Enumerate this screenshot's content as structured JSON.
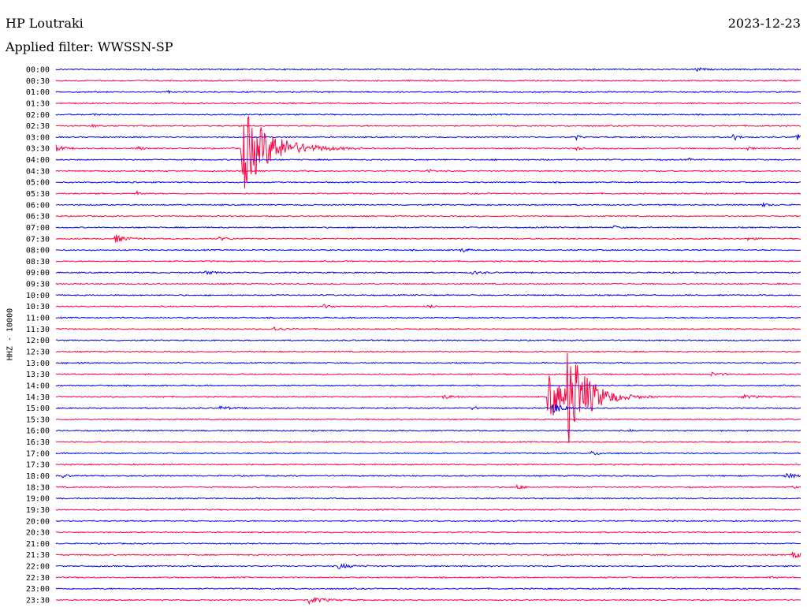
{
  "header": {
    "station": "HP Loutraki",
    "date": "2023-12-23",
    "filter": "Applied filter: WWSSN-SP",
    "channel": "HHZ - 10000"
  },
  "colors": {
    "background": "#ffffff",
    "trace_even": "#0000ee",
    "trace_odd": "#ff0040",
    "text": "#000000"
  },
  "chart_data": {
    "type": "line",
    "subtype": "helicorder",
    "grid": false,
    "time_labels": [
      "00:00",
      "00:30",
      "01:00",
      "01:30",
      "02:00",
      "02:30",
      "03:00",
      "03:30",
      "04:00",
      "04:30",
      "05:00",
      "05:30",
      "06:00",
      "06:30",
      "07:00",
      "07:30",
      "08:00",
      "08:30",
      "09:00",
      "09:30",
      "10:00",
      "10:30",
      "11:00",
      "11:30",
      "12:00",
      "12:30",
      "13:00",
      "13:30",
      "14:00",
      "14:30",
      "15:00",
      "15:30",
      "16:00",
      "16:30",
      "17:00",
      "17:30",
      "18:00",
      "18:30",
      "19:00",
      "19:30",
      "20:00",
      "20:30",
      "21:00",
      "21:30",
      "22:00",
      "22:30",
      "23:00",
      "23:30"
    ],
    "events": [
      {
        "line": 0,
        "x": 0.86,
        "amp": 3,
        "dur": 0.01
      },
      {
        "line": 2,
        "x": 0.15,
        "amp": 1.5,
        "dur": 0.005
      },
      {
        "line": 4,
        "x": 0.05,
        "amp": 1,
        "dur": 0.01
      },
      {
        "line": 5,
        "x": 0.05,
        "amp": 1.5,
        "dur": 0.01
      },
      {
        "line": 6,
        "x": 0.7,
        "amp": 3,
        "dur": 0.005
      },
      {
        "line": 6,
        "x": 0.91,
        "amp": 4,
        "dur": 0.01
      },
      {
        "line": 6,
        "x": 0.995,
        "amp": 8,
        "dur": 0.005
      },
      {
        "line": 7,
        "x": 0.0,
        "amp": 4,
        "dur": 0.015
      },
      {
        "line": 7,
        "x": 0.11,
        "amp": 2,
        "dur": 0.015
      },
      {
        "line": 7,
        "x": 0.25,
        "amp": 55,
        "dur": 0.055
      },
      {
        "line": 7,
        "x": 0.7,
        "amp": 2,
        "dur": 0.01
      },
      {
        "line": 7,
        "x": 0.93,
        "amp": 2,
        "dur": 0.01
      },
      {
        "line": 8,
        "x": 0.85,
        "amp": 2,
        "dur": 0.005
      },
      {
        "line": 9,
        "x": 0.5,
        "amp": 2,
        "dur": 0.01
      },
      {
        "line": 10,
        "x": 0.1,
        "amp": 1,
        "dur": 0.01
      },
      {
        "line": 11,
        "x": 0.11,
        "amp": 2,
        "dur": 0.01
      },
      {
        "line": 12,
        "x": 0.95,
        "amp": 2,
        "dur": 0.01
      },
      {
        "line": 14,
        "x": 0.75,
        "amp": 2,
        "dur": 0.01
      },
      {
        "line": 15,
        "x": 0.08,
        "amp": 5,
        "dur": 0.02
      },
      {
        "line": 15,
        "x": 0.22,
        "amp": 2,
        "dur": 0.02
      },
      {
        "line": 15,
        "x": 0.93,
        "amp": 2,
        "dur": 0.01
      },
      {
        "line": 16,
        "x": 0.545,
        "amp": 4,
        "dur": 0.008
      },
      {
        "line": 18,
        "x": 0.2,
        "amp": 2,
        "dur": 0.02
      },
      {
        "line": 18,
        "x": 0.56,
        "amp": 2,
        "dur": 0.02
      },
      {
        "line": 21,
        "x": 0.36,
        "amp": 2,
        "dur": 0.02
      },
      {
        "line": 21,
        "x": 0.5,
        "amp": 2,
        "dur": 0.01
      },
      {
        "line": 23,
        "x": 0.29,
        "amp": 3,
        "dur": 0.02
      },
      {
        "line": 26,
        "x": 0.03,
        "amp": 1.5,
        "dur": 0.01
      },
      {
        "line": 27,
        "x": 0.88,
        "amp": 2,
        "dur": 0.02
      },
      {
        "line": 29,
        "x": 0.14,
        "amp": 1.5,
        "dur": 0.01
      },
      {
        "line": 29,
        "x": 0.52,
        "amp": 2.5,
        "dur": 0.02
      },
      {
        "line": 29,
        "x": 0.92,
        "amp": 2,
        "dur": 0.03
      },
      {
        "line": 29,
        "x": 0.662,
        "amp": 30,
        "dur": 0.035
      },
      {
        "line": 29,
        "x": 0.688,
        "amp": 60,
        "dur": 0.04
      },
      {
        "line": 30,
        "x": 0.22,
        "amp": 2,
        "dur": 0.02
      },
      {
        "line": 30,
        "x": 0.56,
        "amp": 2,
        "dur": 0.01
      },
      {
        "line": 30,
        "x": 0.668,
        "amp": 7,
        "dur": 0.02
      },
      {
        "line": 32,
        "x": 0.77,
        "amp": 1.5,
        "dur": 0.005
      },
      {
        "line": 34,
        "x": 0.72,
        "amp": 2,
        "dur": 0.02
      },
      {
        "line": 36,
        "x": 0.01,
        "amp": 2,
        "dur": 0.01
      },
      {
        "line": 36,
        "x": 0.98,
        "amp": 4,
        "dur": 0.015
      },
      {
        "line": 37,
        "x": 0.62,
        "amp": 3,
        "dur": 0.008
      },
      {
        "line": 37,
        "x": 0.99,
        "amp": 2,
        "dur": 0.005
      },
      {
        "line": 43,
        "x": 0.99,
        "amp": 4,
        "dur": 0.02
      },
      {
        "line": 44,
        "x": 0.38,
        "amp": 3,
        "dur": 0.025
      },
      {
        "line": 45,
        "x": 0.96,
        "amp": 2,
        "dur": 0.01
      },
      {
        "line": 47,
        "x": 0.34,
        "amp": 4,
        "dur": 0.03
      }
    ]
  }
}
